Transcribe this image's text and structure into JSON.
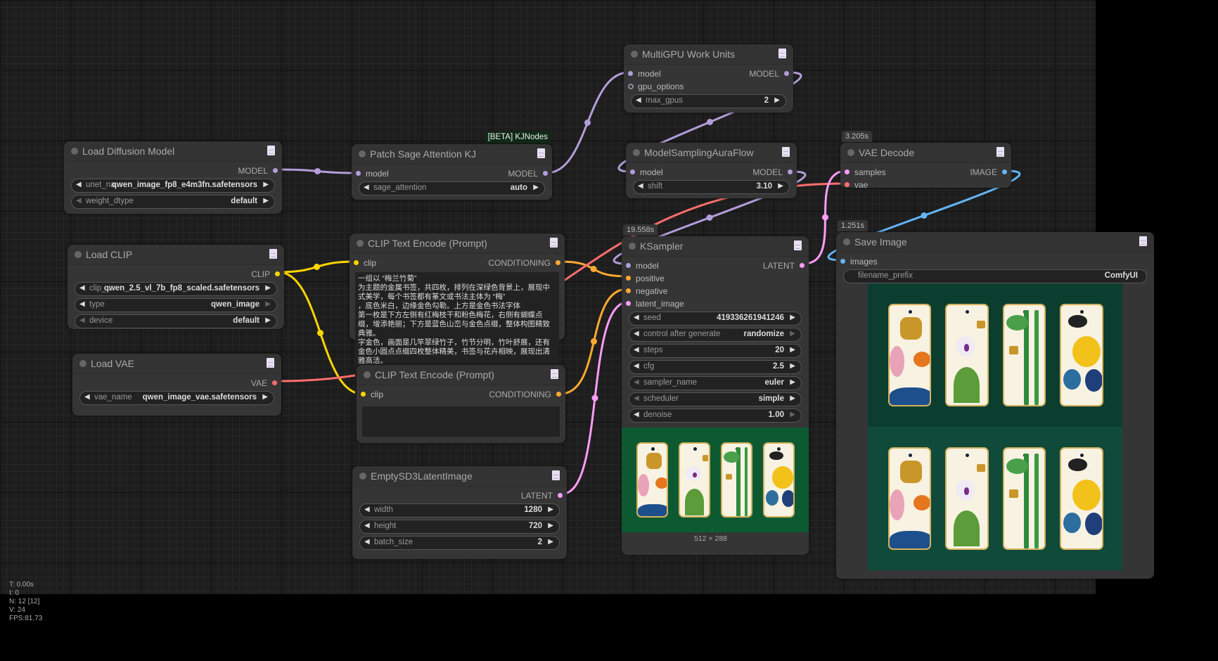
{
  "slot_colors": {
    "MODEL": "#b39ddb",
    "CLIP": "#ffd500",
    "CONDITIONING": "#ffa931",
    "LATENT": "#ff9cf9",
    "VAE": "#ff6e6e",
    "IMAGE": "#64b5f6",
    "GPU": "#8a8a9a"
  },
  "nodes": [
    {
      "id": "load-diffusion-model",
      "title": "Load Diffusion Model",
      "rows": [
        {
          "out": "MODEL",
          "type": "MODEL"
        }
      ],
      "widgets": [
        {
          "label": "unet_na...",
          "value": "qwen_image_fp8_e4m3fn.safetensors",
          "left": true,
          "right": true
        },
        {
          "label": "weight_dtype",
          "value": "default",
          "left": false,
          "right": true
        }
      ]
    },
    {
      "id": "patch-sage-attention",
      "title": "Patch Sage Attention KJ",
      "tag": "[BETA] KJNodes",
      "rows": [
        {
          "in": "model",
          "out": "MODEL",
          "type": "MODEL"
        }
      ],
      "widgets": [
        {
          "label": "sage_attention",
          "value": "auto",
          "left": true,
          "right": true
        }
      ]
    },
    {
      "id": "multigpu-work-units",
      "title": "MultiGPU Work Units",
      "rows": [
        {
          "in": "model",
          "out": "MODEL",
          "type": "MODEL"
        },
        {
          "in": "gpu_options",
          "type": "GPU"
        }
      ],
      "widgets": [
        {
          "label": "max_gpus",
          "value": "2",
          "left": true,
          "right": true
        }
      ]
    },
    {
      "id": "model-sampling-auraflow",
      "title": "ModelSamplingAuraFlow",
      "rows": [
        {
          "in": "model",
          "out": "MODEL",
          "type": "MODEL"
        }
      ],
      "widgets": [
        {
          "label": "shift",
          "value": "3.10",
          "left": true,
          "right": true
        }
      ]
    },
    {
      "id": "vae-decode",
      "title": "VAE Decode",
      "time": "3.205s",
      "rows": [
        {
          "in": "samples",
          "intype": "LATENT",
          "out": "IMAGE",
          "type": "IMAGE"
        },
        {
          "in": "vae",
          "intype": "VAE"
        }
      ],
      "widgets": []
    },
    {
      "id": "load-clip",
      "title": "Load CLIP",
      "rows": [
        {
          "out": "CLIP",
          "type": "CLIP"
        }
      ],
      "widgets": [
        {
          "label": "clip_...",
          "value": "qwen_2.5_vl_7b_fp8_scaled.safetensors",
          "left": true,
          "right": true
        },
        {
          "label": "type",
          "value": "qwen_image",
          "left": true,
          "right": false
        },
        {
          "label": "device",
          "value": "default",
          "left": false,
          "right": true
        }
      ]
    },
    {
      "id": "clip-text-encode-positive",
      "title": "CLIP Text Encode (Prompt)",
      "rows": [
        {
          "in": "clip",
          "intype": "CLIP",
          "out": "CONDITIONING",
          "type": "CONDITIONING"
        }
      ],
      "widgets": [],
      "text": "一组以 “梅兰竹菊”\n为主题的金属书签，共四枚，排列在深绿色背景上，展现中式美学，每个书签都有篆文或书法主体为 “梅”\n，底色米白，边缘金色勾勒。上方是金色书法字体\n第一枚是下方左侧有红梅枝干和粉色梅花，右侧有蝴蝶点缀，增添艳丽；下方是蓝色山峦与金色点缀，整体构图精致典雅。\n字金色，画面是几竿翠绿竹子，竹节分明，竹叶舒展，还有金色小圆点点缀四枚整体精美，书签与花卉相映，展现出清雅高洁。\n字金色，右侧有一大朵金黄菊花，花瓣层叠卷曲，明艳夺目，旁边是深绿叶片与蓝色叶片，左上方有一只黑羽、红喙、白腹的小燕子，为画面增添灵动，整体以珐琅质感呈现，工艺精细，色彩搭配和谐，既具实用功能，又饱含中式文化韵味，是文具也是艺术小物，适合喜爱传统文化之人收藏或使用。"
    },
    {
      "id": "clip-text-encode-negative",
      "title": "CLIP Text Encode (Prompt)",
      "rows": [
        {
          "in": "clip",
          "intype": "CLIP",
          "out": "CONDITIONING",
          "type": "CONDITIONING"
        }
      ],
      "widgets": [],
      "text": ""
    },
    {
      "id": "load-vae",
      "title": "Load VAE",
      "rows": [
        {
          "out": "VAE",
          "type": "VAE"
        }
      ],
      "widgets": [
        {
          "label": "vae_name",
          "value": "qwen_image_vae.safetensors",
          "left": true,
          "right": true
        }
      ]
    },
    {
      "id": "empty-sd3-latent-image",
      "title": "EmptySD3LatentImage",
      "rows": [
        {
          "out": "LATENT",
          "type": "LATENT"
        }
      ],
      "widgets": [
        {
          "label": "width",
          "value": "1280",
          "left": true,
          "right": true
        },
        {
          "label": "height",
          "value": "720",
          "left": true,
          "right": true
        },
        {
          "label": "batch_size",
          "value": "2",
          "left": true,
          "right": true
        }
      ]
    },
    {
      "id": "ksampler",
      "title": "KSampler",
      "time": "19.558s",
      "rows": [
        {
          "in": "model",
          "intype": "MODEL",
          "out": "LATENT",
          "type": "LATENT"
        },
        {
          "in": "positive",
          "intype": "CONDITIONING"
        },
        {
          "in": "negative",
          "intype": "CONDITIONING"
        },
        {
          "in": "latent_image",
          "intype": "LATENT"
        }
      ],
      "widgets": [
        {
          "label": "seed",
          "value": "419336261941246",
          "left": true,
          "right": true
        },
        {
          "label": "control after generate",
          "value": "randomize",
          "left": true,
          "right": false
        },
        {
          "label": "steps",
          "value": "20",
          "left": true,
          "right": true
        },
        {
          "label": "cfg",
          "value": "2.5",
          "left": true,
          "right": true
        },
        {
          "label": "sampler_name",
          "value": "euler",
          "left": false,
          "right": true
        },
        {
          "label": "scheduler",
          "value": "simple",
          "left": false,
          "right": true
        },
        {
          "label": "denoise",
          "value": "1.00",
          "left": true,
          "right": false
        }
      ],
      "preview_caption": "512 × 288"
    },
    {
      "id": "save-image",
      "title": "Save Image",
      "time": "1.251s",
      "rows": [
        {
          "in": "images",
          "intype": "IMAGE"
        }
      ],
      "widgets": [
        {
          "label": "filename_prefix",
          "value": "ComfyUI",
          "left": false,
          "right": false
        }
      ]
    }
  ],
  "stats": {
    "t": "T: 0.00s",
    "i": "I: 0",
    "n": "N: 12 [12]",
    "v": "V: 24",
    "fps": "FPS:81.73"
  }
}
